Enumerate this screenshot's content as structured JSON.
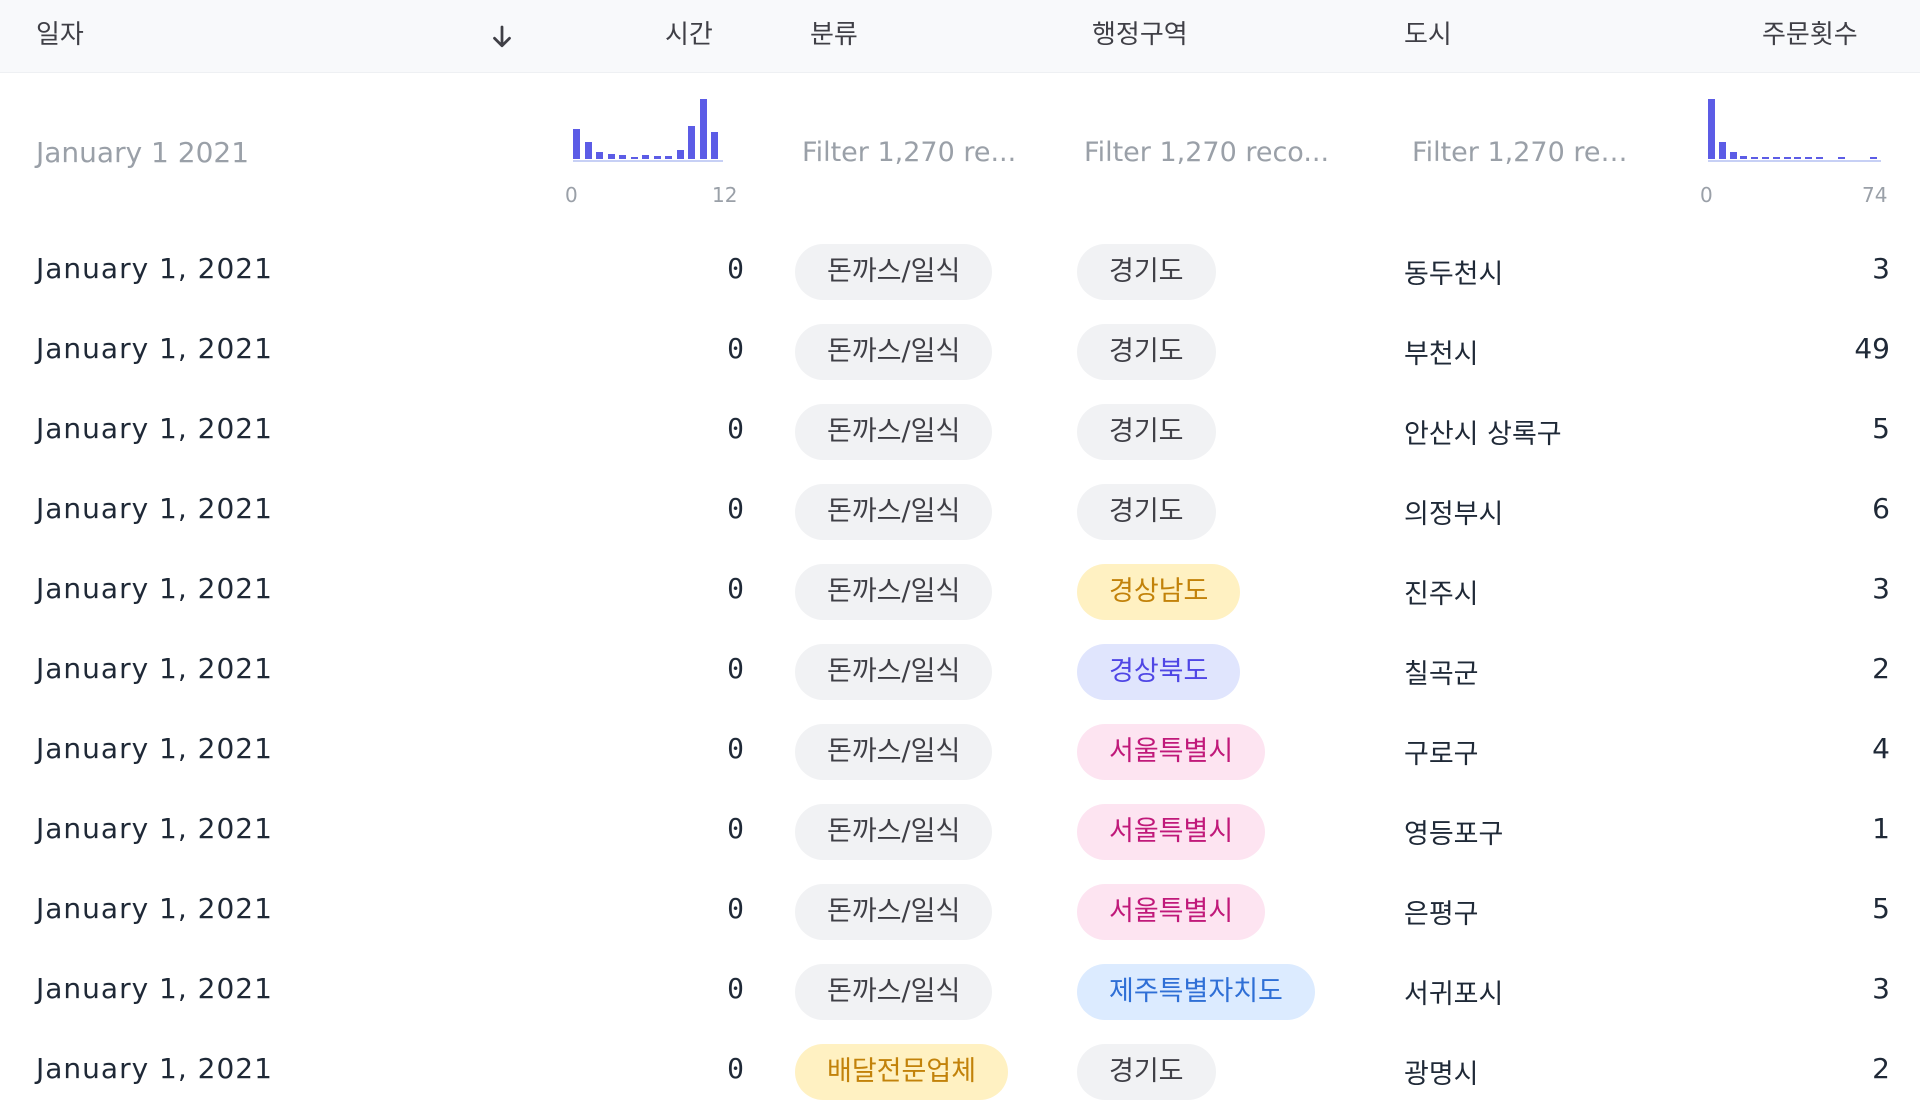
{
  "columns": {
    "date": "일자",
    "time": "시간",
    "category": "분류",
    "region": "행정구역",
    "city": "도시",
    "orders": "주문횟수"
  },
  "sort_icon": "arrow-down-icon",
  "filters": {
    "date_value": "January 1 2021",
    "category_placeholder": "Filter 1,270 re...",
    "region_placeholder": "Filter 1,270 reco...",
    "city_placeholder": "Filter 1,270 rec...",
    "time_hist": {
      "min": "0",
      "max": "12",
      "bars": [
        0.5,
        0.28,
        0.12,
        0.08,
        0.06,
        0.04,
        0.06,
        0.05,
        0.05,
        0.15,
        0.55,
        1.0,
        0.45
      ]
    },
    "orders_hist": {
      "min": "0",
      "max": "74",
      "bars": [
        1.0,
        0.28,
        0.12,
        0.05,
        0.04,
        0.03,
        0.03,
        0.03,
        0.03,
        0.03,
        0.03,
        0,
        0.03,
        0,
        0,
        0.03
      ]
    }
  },
  "pill_colors": {
    "gray": {
      "bg": "#f1f2f4",
      "fg": "#3f3f46"
    },
    "yellow": {
      "bg": "#fff1c2",
      "fg": "#c2820a"
    },
    "indigo": {
      "bg": "#e0e5fd",
      "fg": "#4f46e5"
    },
    "pink": {
      "bg": "#fde4f1",
      "fg": "#c0197a"
    },
    "blue": {
      "bg": "#dcebff",
      "fg": "#2f6fd6"
    }
  },
  "rows": [
    {
      "date": "January 1, 2021",
      "time": "0",
      "category": "돈까스/일식",
      "category_color": "gray",
      "region": "경기도",
      "region_color": "gray",
      "city": "동두천시",
      "orders": "3"
    },
    {
      "date": "January 1, 2021",
      "time": "0",
      "category": "돈까스/일식",
      "category_color": "gray",
      "region": "경기도",
      "region_color": "gray",
      "city": "부천시",
      "orders": "49"
    },
    {
      "date": "January 1, 2021",
      "time": "0",
      "category": "돈까스/일식",
      "category_color": "gray",
      "region": "경기도",
      "region_color": "gray",
      "city": "안산시 상록구",
      "orders": "5"
    },
    {
      "date": "January 1, 2021",
      "time": "0",
      "category": "돈까스/일식",
      "category_color": "gray",
      "region": "경기도",
      "region_color": "gray",
      "city": "의정부시",
      "orders": "6"
    },
    {
      "date": "January 1, 2021",
      "time": "0",
      "category": "돈까스/일식",
      "category_color": "gray",
      "region": "경상남도",
      "region_color": "yellow",
      "city": "진주시",
      "orders": "3"
    },
    {
      "date": "January 1, 2021",
      "time": "0",
      "category": "돈까스/일식",
      "category_color": "gray",
      "region": "경상북도",
      "region_color": "indigo",
      "city": "칠곡군",
      "orders": "2"
    },
    {
      "date": "January 1, 2021",
      "time": "0",
      "category": "돈까스/일식",
      "category_color": "gray",
      "region": "서울특별시",
      "region_color": "pink",
      "city": "구로구",
      "orders": "4"
    },
    {
      "date": "January 1, 2021",
      "time": "0",
      "category": "돈까스/일식",
      "category_color": "gray",
      "region": "서울특별시",
      "region_color": "pink",
      "city": "영등포구",
      "orders": "1"
    },
    {
      "date": "January 1, 2021",
      "time": "0",
      "category": "돈까스/일식",
      "category_color": "gray",
      "region": "서울특별시",
      "region_color": "pink",
      "city": "은평구",
      "orders": "5"
    },
    {
      "date": "January 1, 2021",
      "time": "0",
      "category": "돈까스/일식",
      "category_color": "gray",
      "region": "제주특별자치도",
      "region_color": "blue",
      "city": "서귀포시",
      "orders": "3"
    },
    {
      "date": "January 1, 2021",
      "time": "0",
      "category": "배달전문업체",
      "category_color": "yellow",
      "region": "경기도",
      "region_color": "gray",
      "city": "광명시",
      "orders": "2"
    }
  ]
}
